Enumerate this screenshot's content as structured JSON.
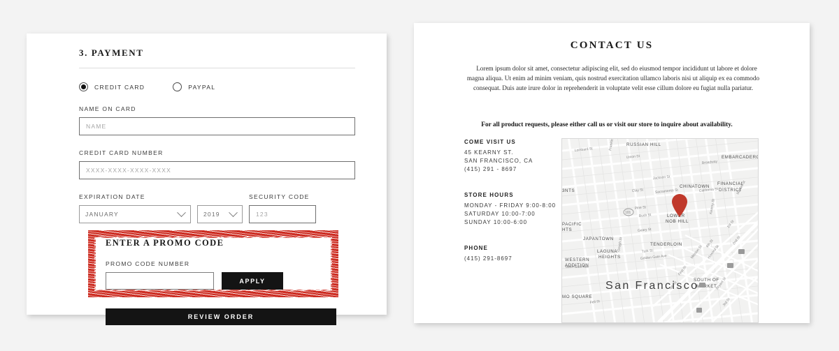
{
  "checkout": {
    "section_number_title": "3. PAYMENT",
    "payment_methods": [
      {
        "label": "CREDIT CARD",
        "selected": true
      },
      {
        "label": "PAYPAL",
        "selected": false
      }
    ],
    "fields": {
      "name_label": "NAME ON CARD",
      "name_placeholder": "NAME",
      "name_value": "",
      "card_label": "CREDIT CARD NUMBER",
      "card_placeholder": "XXXX-XXXX-XXXX-XXXX",
      "card_value": "",
      "expiration_label": "EXPIRATION DATE",
      "month_value": "JANUARY",
      "year_value": "2019",
      "security_label": "SECURITY CODE",
      "security_placeholder": "123",
      "security_value": ""
    },
    "promo": {
      "title": "ENTER A PROMO CODE",
      "input_label": "PROMO CODE NUMBER",
      "input_value": "",
      "apply_label": "APPLY"
    },
    "review_label": "REVIEW ORDER"
  },
  "contact": {
    "title": "CONTACT US",
    "paragraph": "Lorem ipsum dolor sit amet, consectetur adipiscing elit, sed do eiusmod tempor incididunt ut labore et dolore magna aliqua. Ut enim ad minim veniam, quis nostrud exercitation ullamco laboris nisi ut aliquip ex ea commodo consequat. Duis aute irure dolor in reprehenderit in voluptate velit esse cillum dolore eu fugiat nulla pariatur.",
    "highlighted_notice": "For all product requests, please either call us or visit our store to inquire about availability.",
    "visit": {
      "heading": "COME VISIT US",
      "lines": [
        "45 KEARNY ST.",
        "SAN FRANCISCO, CA",
        "(415) 291 - 8697"
      ]
    },
    "hours": {
      "heading": "STORE HOURS",
      "lines": [
        "MONDAY - FRIDAY 9:00-8:00",
        "SATURDAY 10:00-7:00",
        "SUNDAY 10:00-6:00"
      ]
    },
    "phone": {
      "heading": "PHONE",
      "lines": [
        "(415) 291-8697"
      ]
    },
    "map": {
      "city_label": "San Francisco",
      "pin": "map-pin-marker",
      "neighborhoods": [
        "RUSSIAN HILL",
        "EMBARCADERO",
        "CHINATOWN",
        "FINANCIAL DISTRICT",
        "LOWER NOB HILL",
        "JAPANTOWN",
        "LAGUNA HEIGHTS",
        "TENDERLOIN",
        "WESTERN ADDITION",
        "SOUTH OF MARKET",
        "PACIFIC HTS",
        "MO SQUARE"
      ],
      "streets": [
        "Lombard St",
        "Union St",
        "Broadway",
        "Jackson St",
        "Clay St",
        "Sacramento St",
        "California St",
        "Pine St",
        "Bush St",
        "Geary St",
        "Turk St",
        "Golden Gate Ave",
        "Franklin St",
        "Gough St",
        "Kearny St",
        "Market St",
        "Mission St",
        "Howard St",
        "Bryant St",
        "1st St",
        "3rd St",
        "4th St",
        "5th St",
        "6th St"
      ]
    }
  },
  "annotations": {
    "marker_color": "#cc2419",
    "promo_highlight": "promo-code-section",
    "notice_highlight": "product-requests-notice"
  }
}
